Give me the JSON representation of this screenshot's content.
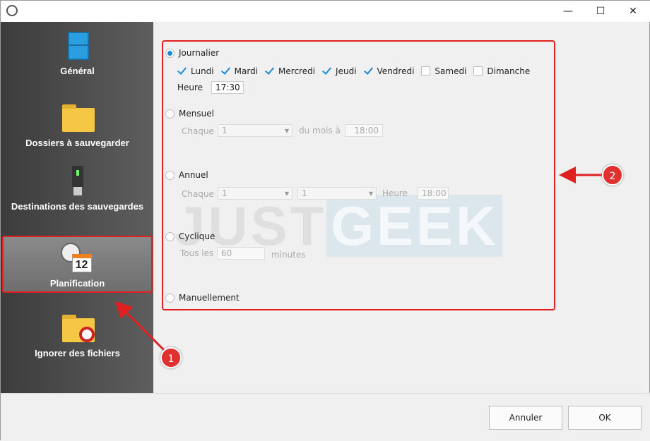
{
  "window": {
    "minimize": "—",
    "maximize": "☐",
    "close": "✕"
  },
  "sidebar": {
    "items": [
      {
        "label": "Général",
        "icon": "cabinet-icon"
      },
      {
        "label": "Dossiers à sauvegarder",
        "icon": "folder-icon"
      },
      {
        "label": "Destinations des sauvegardes",
        "icon": "usb-drive-icon"
      },
      {
        "label": "Planification",
        "icon": "clock-calendar-icon",
        "selected": true,
        "calendar_day": "12"
      },
      {
        "label": "Ignorer des fichiers",
        "icon": "folder-blocked-icon"
      }
    ]
  },
  "schedule": {
    "daily": {
      "label": "Journalier",
      "selected": true,
      "days": [
        {
          "label": "Lundi",
          "checked": true
        },
        {
          "label": "Mardi",
          "checked": true
        },
        {
          "label": "Mercredi",
          "checked": true
        },
        {
          "label": "Jeudi",
          "checked": true
        },
        {
          "label": "Vendredi",
          "checked": true
        },
        {
          "label": "Samedi",
          "checked": false
        },
        {
          "label": "Dimanche",
          "checked": false
        }
      ],
      "hour_label": "Heure",
      "hour": "17:30"
    },
    "monthly": {
      "label": "Mensuel",
      "every_label": "Chaque",
      "day": "1",
      "of_month_label": "du mois à",
      "hour": "18:00"
    },
    "yearly": {
      "label": "Annuel",
      "every_label": "Chaque",
      "day": "1",
      "month": "1",
      "hour_label": "Heure",
      "hour": "18:00"
    },
    "cyclic": {
      "label": "Cyclique",
      "every_label": "Tous les",
      "value": "60",
      "unit": "minutes"
    },
    "manual": {
      "label": "Manuellement"
    }
  },
  "watermark": {
    "part1": "JUST",
    "part2": "GEEK"
  },
  "callouts": [
    "1",
    "2"
  ],
  "footer": {
    "cancel": "Annuler",
    "ok": "OK"
  },
  "colors": {
    "accent": "#1a8ad8",
    "highlight": "#e02020"
  }
}
